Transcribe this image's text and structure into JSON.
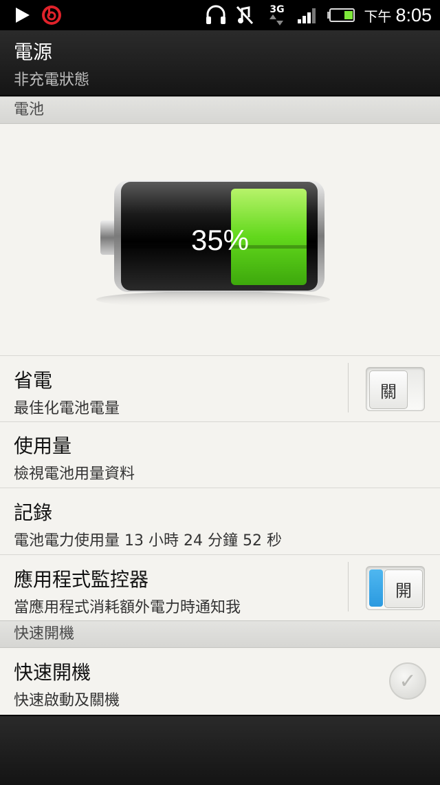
{
  "status_bar": {
    "icons": [
      "play-store-icon",
      "beats-audio-icon",
      "headphones-icon",
      "vibrate-off-icon",
      "network-3g-icon",
      "signal-icon",
      "battery-icon"
    ],
    "network_label": "3G",
    "ampm": "下午",
    "time": "8:05"
  },
  "header": {
    "title": "電源",
    "subtitle": "非充電狀態"
  },
  "sections": {
    "battery": "電池",
    "fast_boot": "快速開機"
  },
  "battery": {
    "percent_label": "35%",
    "level": 0.35,
    "fill_color": "#7ee83a"
  },
  "rows": {
    "power_saver": {
      "title": "省電",
      "subtitle": "最佳化電池電量",
      "toggle_label": "關",
      "state": "off"
    },
    "usage": {
      "title": "使用量",
      "subtitle": "檢視電池用量資料"
    },
    "history": {
      "title": "記錄",
      "subtitle": "電池電力使用量 13 小時 24 分鐘 52 秒"
    },
    "app_monitor": {
      "title": "應用程式監控器",
      "subtitle": "當應用程式消耗額外電力時通知我",
      "toggle_label": "開",
      "state": "on"
    },
    "fast_boot": {
      "title": "快速開機",
      "subtitle": "快速啟動及關機",
      "checked": false
    }
  },
  "colors": {
    "accent": "#2b9ae0",
    "background": "#f4f3ef"
  }
}
